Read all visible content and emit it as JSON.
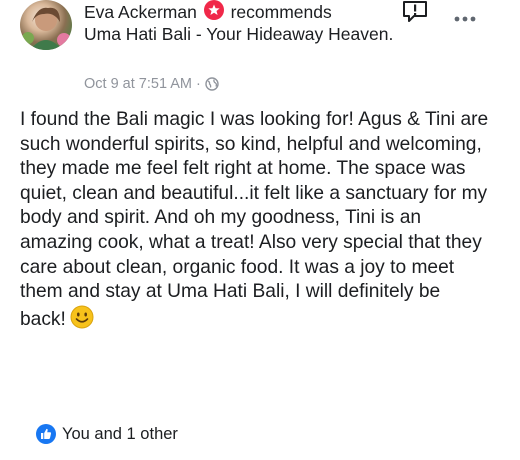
{
  "post": {
    "author": "Eva Ackerman",
    "action": "recommends",
    "page": "Uma Hati Bali - Your Hideaway Heaven.",
    "timestamp": "Oct 9 at 7:51 AM",
    "separator": "·",
    "body": "I found the Bali magic I was looking for! Agus & Tini are such wonderful spirits, so kind, helpful and welcoming, they made me feel felt right at home. The space was quiet, clean and beautiful...it felt like a sanctuary for my body and spirit. And oh my goodness, Tini is an amazing cook, what a treat! Also very special that they care about clean, organic food. It was a joy to meet them and stay at Uma Hati Bali, I will definitely be back!",
    "reactions_text": "You and 1 other"
  },
  "icons": {
    "recommend": "recommend-badge-icon",
    "report": "report-icon",
    "more": "more-options-icon",
    "audience": "globe-icon",
    "emoji": "smiling-face-emoji",
    "like": "like-reaction-icon"
  },
  "colors": {
    "text": "#1c1e21",
    "meta": "#90949c",
    "recommend_red": "#f02849",
    "like_blue": "#1877f2",
    "emoji_yellow": "#f7c21b"
  }
}
